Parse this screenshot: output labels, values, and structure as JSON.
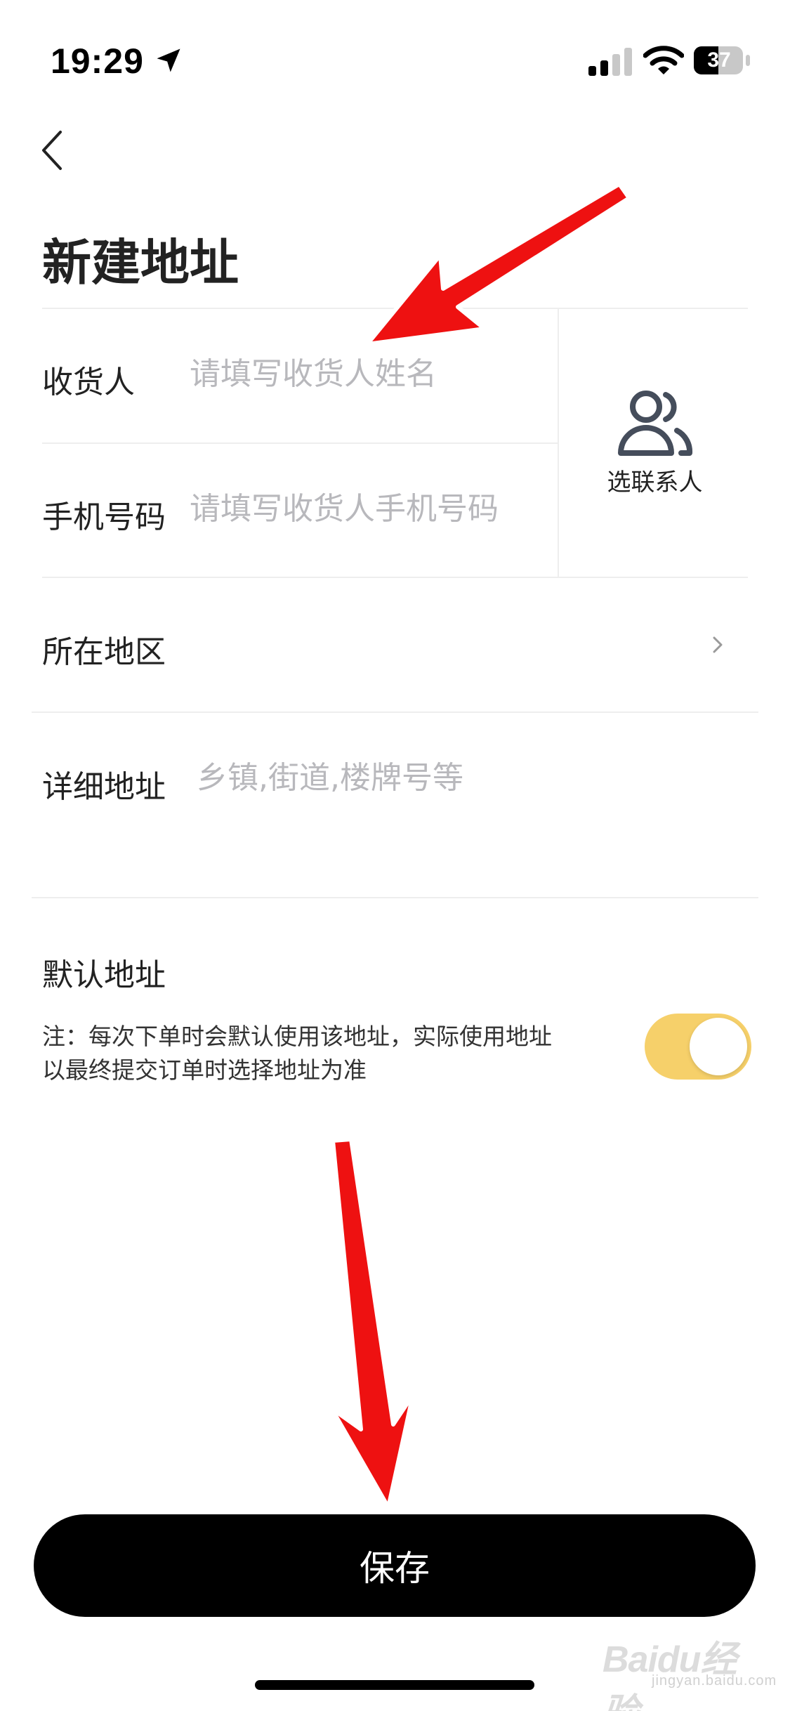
{
  "status_bar": {
    "time": "19:29",
    "battery_level": "37"
  },
  "page": {
    "title": "新建地址"
  },
  "form": {
    "consignee": {
      "label": "收货人",
      "placeholder": "请填写收货人姓名",
      "value": ""
    },
    "phone": {
      "label": "手机号码",
      "placeholder": "请填写收货人手机号码",
      "value": ""
    },
    "region": {
      "label": "所在地区",
      "value": ""
    },
    "detail": {
      "label": "详细地址",
      "placeholder": "乡镇,街道,楼牌号等",
      "value": ""
    }
  },
  "contact_picker": {
    "label": "选联系人",
    "icon": "contacts-icon"
  },
  "default_address": {
    "title": "默认地址",
    "note": "注：每次下单时会默认使用该地址，实际使用地址以最终提交订单时选择地址为准",
    "enabled": true,
    "toggle_color": "#f6d06a"
  },
  "actions": {
    "save_label": "保存"
  },
  "annotations": {
    "arrow_color": "#ee1111"
  },
  "watermark": {
    "mark": "Baidu经验",
    "sub": "jingyan.baidu.com"
  }
}
